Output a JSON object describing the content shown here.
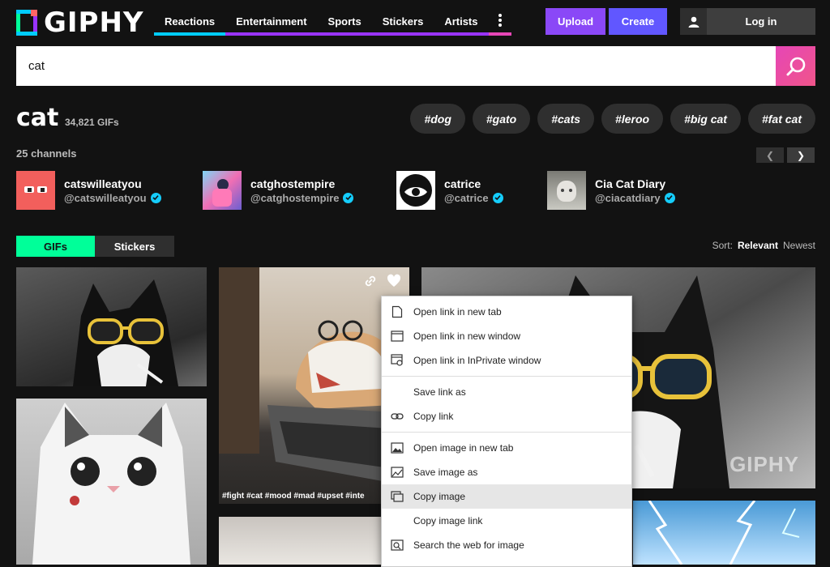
{
  "header": {
    "logo_text": "GIPHY",
    "nav": [
      {
        "label": "Reactions",
        "color": "#00ccff"
      },
      {
        "label": "Entertainment",
        "color": "#9933ff"
      },
      {
        "label": "Sports",
        "color": "#00ff99"
      },
      {
        "label": "Stickers",
        "color": "#9933ff"
      },
      {
        "label": "Artists",
        "color": "#ff6666"
      }
    ],
    "more_icon": "vertical-dots-icon",
    "upload_label": "Upload",
    "create_label": "Create",
    "login_label": "Log in"
  },
  "search": {
    "value": "cat",
    "icon": "search-icon"
  },
  "results": {
    "query": "cat",
    "count": "34,821 GIFs",
    "tags": [
      "#dog",
      "#gato",
      "#cats",
      "#leroo",
      "#big cat",
      "#fat cat"
    ]
  },
  "channels": {
    "count_label": "25 channels",
    "items": [
      {
        "name": "catswilleatyou",
        "handle": "@catswilleatyou"
      },
      {
        "name": "catghostempire",
        "handle": "@catghostempire"
      },
      {
        "name": "catrice",
        "handle": "@catrice"
      },
      {
        "name": "Cia Cat Diary",
        "handle": "@ciacatdiary"
      }
    ]
  },
  "tabs": {
    "gifs": "GIFs",
    "stickers": "Stickers"
  },
  "sort": {
    "label": "Sort:",
    "relevant": "Relevant",
    "newest": "Newest"
  },
  "gifs": {
    "caption_2": "#fight #cat #mood #mad #upset #inte",
    "watermark": "GIPHY"
  },
  "context_menu": {
    "items": [
      {
        "label": "Open link in new tab",
        "icon": "new-tab-icon"
      },
      {
        "label": "Open link in new window",
        "icon": "new-window-icon"
      },
      {
        "label": "Open link in InPrivate window",
        "icon": "inprivate-window-icon"
      },
      {
        "label": "Save link as",
        "icon": ""
      },
      {
        "label": "Copy link",
        "icon": "link-icon"
      },
      {
        "label": "Open image in new tab",
        "icon": "image-tab-icon"
      },
      {
        "label": "Save image as",
        "icon": "save-image-icon"
      },
      {
        "label": "Copy image",
        "icon": "copy-image-icon"
      },
      {
        "label": "Copy image link",
        "icon": ""
      },
      {
        "label": "Search the web for image",
        "icon": "search-image-icon"
      }
    ]
  },
  "colors": {
    "background": "#121212",
    "upload": "#8a48f7",
    "create": "#6157ff",
    "gifs_tab": "#00ff99",
    "verified": "#15cdfc",
    "search_button": "#e646b6"
  }
}
